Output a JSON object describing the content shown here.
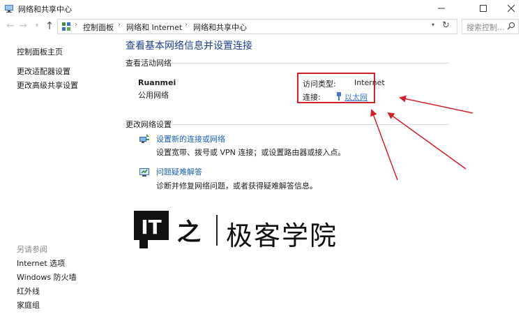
{
  "window": {
    "title": "网络和共享中心",
    "controls": [
      "minimize-icon",
      "maximize-icon",
      "close-icon"
    ]
  },
  "address_bar": {
    "breadcrumbs": [
      "控制面板",
      "网络和 Internet",
      "网络和共享中心"
    ],
    "search_placeholder": "搜索控制..."
  },
  "sidebar": {
    "links": [
      {
        "label": "控制面板主页"
      },
      {
        "label": "更改适配器设置"
      },
      {
        "label": "更改高级共享设置"
      }
    ],
    "see_also_label": "另请参阅",
    "see_also": [
      {
        "label": "Internet 选项"
      },
      {
        "label": "Windows 防火墙"
      },
      {
        "label": "红外线"
      },
      {
        "label": "家庭组"
      }
    ]
  },
  "main": {
    "title": "查看基本网络信息并设置连接",
    "active_networks_label": "查看活动网络",
    "network": {
      "name": "Ruanmei",
      "category": "公用网络",
      "access_type_label": "访问类型:",
      "access_type_value": "Internet",
      "connections_label": "连接:",
      "connection_value": "以太网"
    },
    "change_settings_label": "更改网络设置",
    "tasks": [
      {
        "link": "设置新的连接或网络",
        "desc": "设置宽带、拨号或 VPN 连接；或设置路由器或接入点。",
        "icon": "network-setup-icon"
      },
      {
        "link": "问题疑难解答",
        "desc": "诊断并修复网络问题，或者获得疑难解答信息。",
        "icon": "troubleshoot-icon"
      }
    ]
  },
  "watermark": {
    "logo_text": "IT之家",
    "text": "极客学院"
  },
  "colors": {
    "highlight": "#d0202a",
    "link": "#1a5fb4",
    "title": "#1e3f8e"
  }
}
